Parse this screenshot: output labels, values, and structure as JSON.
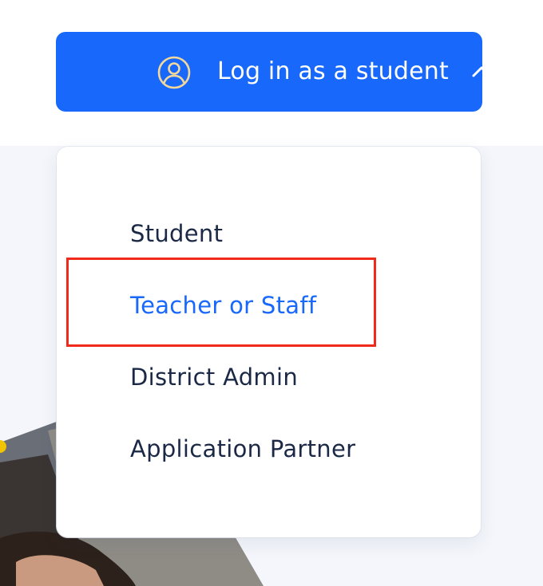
{
  "login_button": {
    "label": "Log in as a student",
    "icon": "user-circle-icon",
    "chevron_icon": "chevron-up-icon",
    "color": "#1868fb"
  },
  "menu": {
    "items": [
      {
        "label": "Student",
        "active": false
      },
      {
        "label": "Teacher or Staff",
        "active": true
      },
      {
        "label": "District Admin",
        "active": false
      },
      {
        "label": "Application Partner",
        "active": false
      }
    ],
    "active_color": "#1868fb",
    "text_color": "#1b2947"
  },
  "annotation": {
    "highlight_color": "#f0291a"
  }
}
